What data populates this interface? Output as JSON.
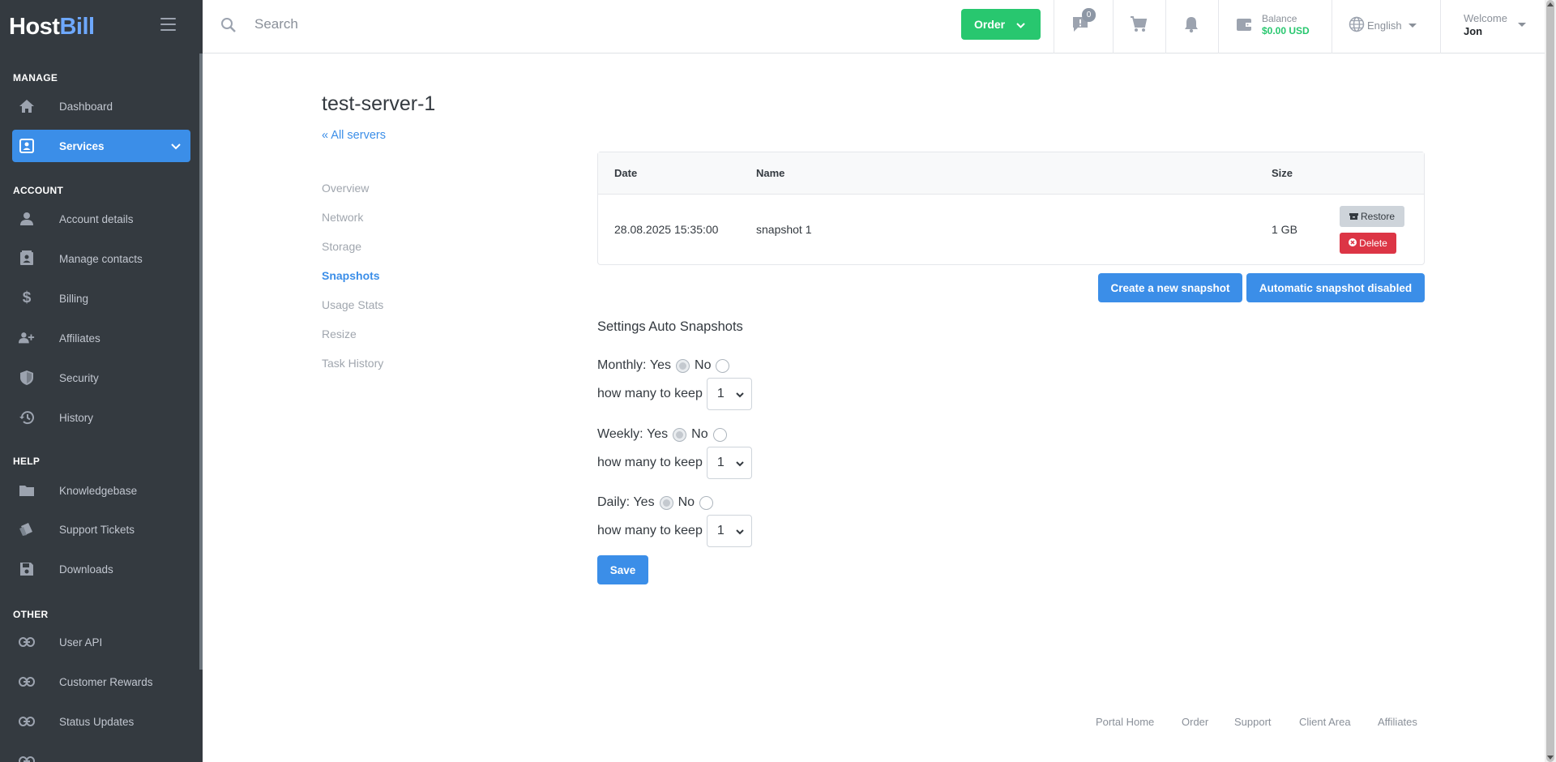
{
  "brand": {
    "host": "Host",
    "bill": "Bill"
  },
  "sidebar": {
    "sections": [
      {
        "title": "MANAGE",
        "items": [
          {
            "label": "Dashboard",
            "icon": "home-icon"
          },
          {
            "label": "Services",
            "icon": "id-card-icon",
            "active": true
          }
        ]
      },
      {
        "title": "ACCOUNT",
        "items": [
          {
            "label": "Account details",
            "icon": "user-icon"
          },
          {
            "label": "Manage contacts",
            "icon": "contacts-icon"
          },
          {
            "label": "Billing",
            "icon": "dollar-icon"
          },
          {
            "label": "Affiliates",
            "icon": "user-plus-icon"
          },
          {
            "label": "Security",
            "icon": "shield-icon"
          },
          {
            "label": "History",
            "icon": "history-icon"
          }
        ]
      },
      {
        "title": "HELP",
        "items": [
          {
            "label": "Knowledgebase",
            "icon": "book-icon"
          },
          {
            "label": "Support Tickets",
            "icon": "tickets-icon"
          },
          {
            "label": "Downloads",
            "icon": "save-icon"
          }
        ]
      },
      {
        "title": "OTHER",
        "items": [
          {
            "label": "User API",
            "icon": "link-icon"
          },
          {
            "label": "Customer Rewards",
            "icon": "link-icon"
          },
          {
            "label": "Status Updates",
            "icon": "link-icon"
          }
        ]
      }
    ]
  },
  "topbar": {
    "search_placeholder": "Search",
    "order_label": "Order",
    "notifications_count": "0",
    "balance_label": "Balance",
    "balance_value": "$0.00 USD",
    "language": "English",
    "welcome_label": "Welcome",
    "user_name": "Jon"
  },
  "page": {
    "title": "test-server-1",
    "back_link": "« All servers",
    "subnav": [
      "Overview",
      "Network",
      "Storage",
      "Snapshots",
      "Usage Stats",
      "Resize",
      "Task History"
    ],
    "subnav_active": "Snapshots"
  },
  "snapshots_table": {
    "headers": {
      "date": "Date",
      "name": "Name",
      "size": "Size"
    },
    "rows": [
      {
        "date": "28.08.2025 15:35:00",
        "name": "snapshot 1",
        "size": "1 GB",
        "restore_label": "Restore",
        "delete_label": "Delete"
      }
    ]
  },
  "actions": {
    "create_snapshot": "Create a new snapshot",
    "automatic_snapshot": "Automatic snapshot disabled"
  },
  "settings": {
    "title": "Settings Auto Snapshots",
    "yes_label": "Yes",
    "no_label": "No",
    "keep_label": "how many to keep",
    "monthly": {
      "label": "Monthly:",
      "keep": "1"
    },
    "weekly": {
      "label": "Weekly:",
      "keep": "1"
    },
    "daily": {
      "label": "Daily:",
      "keep": "1"
    },
    "save_label": "Save"
  },
  "footer": [
    "Portal Home",
    "Order",
    "Support",
    "Client Area",
    "Affiliates"
  ],
  "colors": {
    "primary": "#3b8ee8",
    "success": "#28c76f",
    "danger": "#dc3545",
    "sidebar": "#343a40"
  }
}
